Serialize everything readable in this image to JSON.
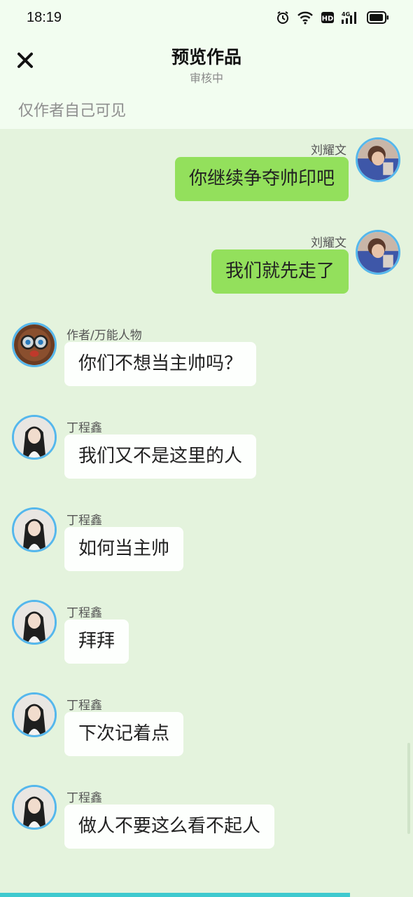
{
  "status_bar": {
    "time": "18:19",
    "icons": [
      "alarm-icon",
      "wifi-icon",
      "hd-icon",
      "4g-signal-icon",
      "battery-icon"
    ]
  },
  "header": {
    "close_icon": "close-icon",
    "title": "预览作品",
    "subtitle": "审核中",
    "visibility_note": "仅作者自己可见"
  },
  "colors": {
    "background": "#e4f3dd",
    "header_bg": "#f2fdf0",
    "sent_bubble": "#93e05c",
    "received_bubble": "#fdfffd",
    "avatar_ring": "#55b7ec"
  },
  "messages": [
    {
      "side": "right",
      "name": "刘耀文",
      "text": "你继续争夺帅印吧"
    },
    {
      "side": "right",
      "name": "刘耀文",
      "text": "我们就先走了"
    },
    {
      "side": "left",
      "name": "作者/万能人物",
      "text": "你们不想当主帅吗？"
    },
    {
      "side": "left",
      "name": "丁程鑫",
      "text": "我们又不是这里的人"
    },
    {
      "side": "left",
      "name": "丁程鑫",
      "text": "如何当主帅"
    },
    {
      "side": "left",
      "name": "丁程鑫",
      "text": "拜拜"
    },
    {
      "side": "left",
      "name": "丁程鑫",
      "text": "下次记着点"
    },
    {
      "side": "left",
      "name": "丁程鑫",
      "text": "做人不要这么看不起人"
    }
  ]
}
